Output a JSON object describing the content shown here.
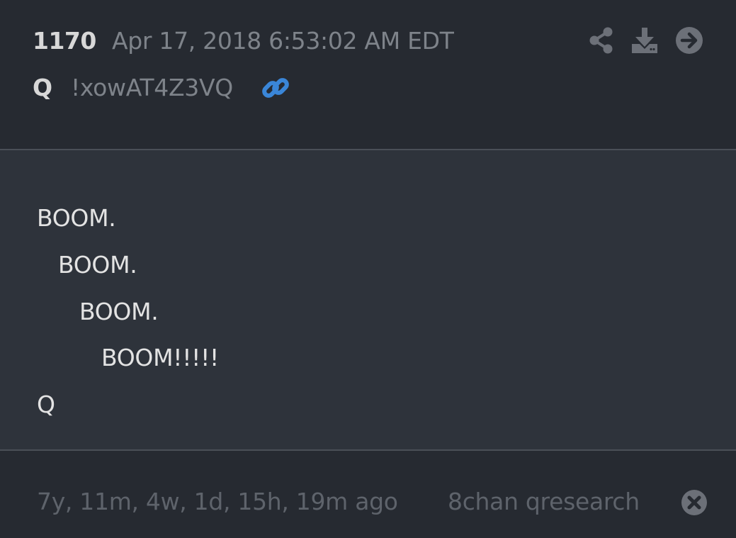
{
  "header": {
    "post_number": "1170",
    "date": "Apr 17, 2018 6:53:02 AM EDT",
    "author": "Q",
    "tripcode": "!xowAT4Z3VQ"
  },
  "body": {
    "lines": [
      "BOOM.",
      "BOOM.",
      "BOOM.",
      "BOOM!!!!!",
      "Q"
    ]
  },
  "footer": {
    "elapsed": "7y, 11m, 4w, 1d, 15h, 19m ago",
    "source": "8chan qresearch"
  },
  "icons": {
    "link": "link-icon",
    "share": "share-icon",
    "download": "download-icon",
    "goto": "arrow-circle-right-icon",
    "close": "close-circle-icon"
  },
  "colors": {
    "link_accent": "#3a86d8",
    "header_bg": "#262a31",
    "body_bg": "#2e333b",
    "icon_gray": "#6c7078"
  }
}
